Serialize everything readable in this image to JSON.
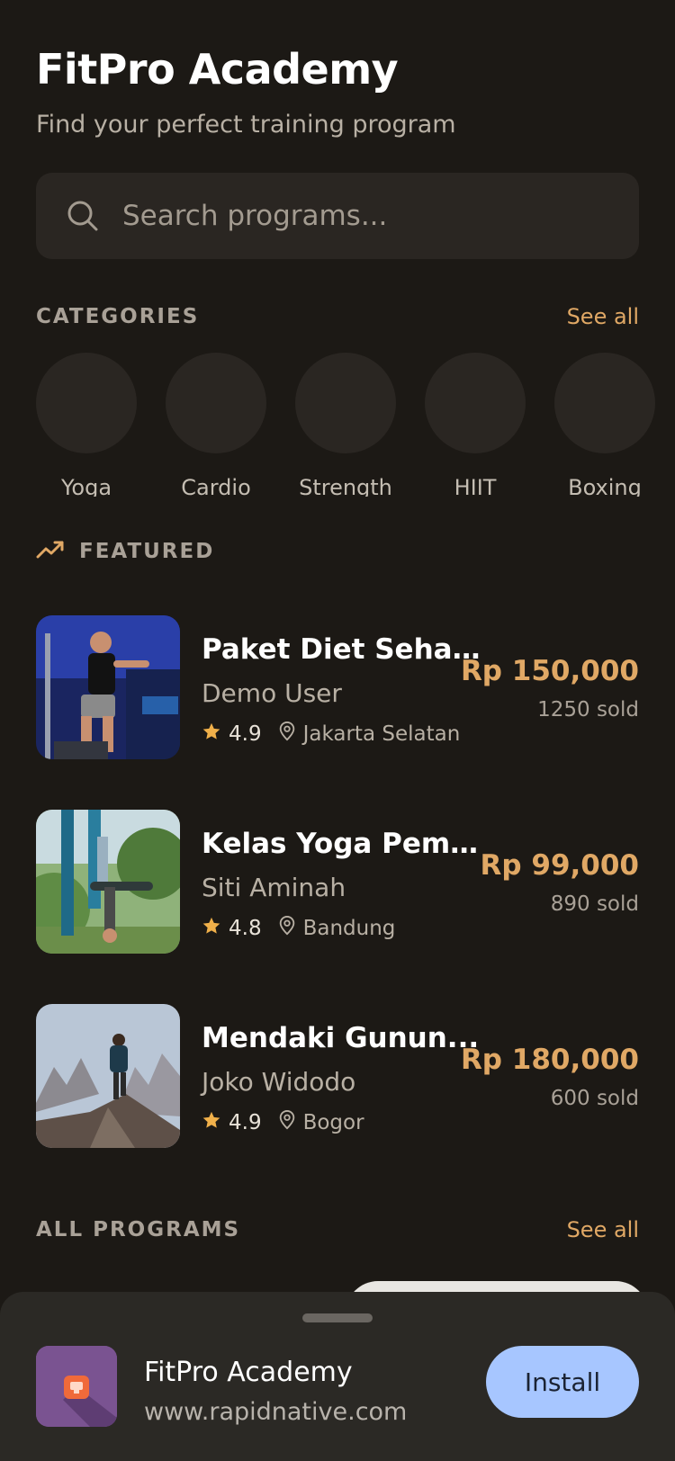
{
  "header": {
    "title": "FitPro Academy",
    "subtitle": "Find your perfect training program"
  },
  "search": {
    "placeholder": "Search programs...",
    "icon": "search-icon"
  },
  "categories": {
    "title": "CATEGORIES",
    "see_all": "See all",
    "items": [
      {
        "label": "Yoga"
      },
      {
        "label": "Cardio"
      },
      {
        "label": "Strength"
      },
      {
        "label": "HIIT"
      },
      {
        "label": "Boxing"
      }
    ]
  },
  "featured": {
    "title": "FEATURED",
    "icon": "trending-up-icon",
    "items": [
      {
        "name": "Paket Diet Sehat...",
        "author": "Demo User",
        "rating": "4.9",
        "location": "Jakarta Selatan",
        "price": "Rp 150,000",
        "sold": "1250 sold"
      },
      {
        "name": "Kelas Yoga Pemul...",
        "author": "Siti Aminah",
        "rating": "4.8",
        "location": "Bandung",
        "price": "Rp 99,000",
        "sold": "890 sold"
      },
      {
        "name": "Mendaki Gunun...",
        "author": "Joko Widodo",
        "rating": "4.9",
        "location": "Bogor",
        "price": "Rp 180,000",
        "sold": "600 sold"
      }
    ]
  },
  "all_programs": {
    "title": "ALL PROGRAMS",
    "see_all": "See all"
  },
  "install_sheet": {
    "app_name": "FitPro Academy",
    "url": "www.rapidnative.com",
    "install_label": "Install"
  },
  "colors": {
    "background": "#1c1915",
    "accent": "#e0a865",
    "star": "#f0b04a",
    "install_button": "#a7c6ff"
  }
}
